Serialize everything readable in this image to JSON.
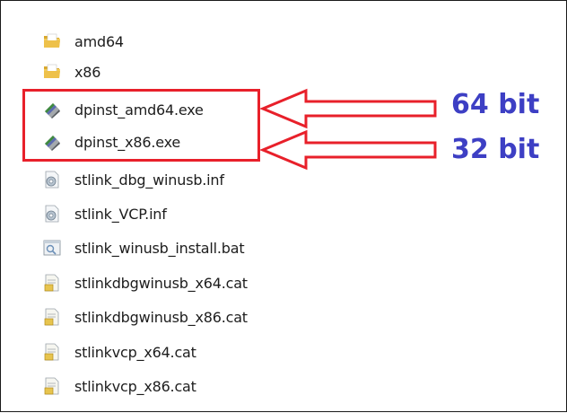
{
  "explorer": {
    "items": [
      {
        "name": "amd64",
        "icon": "folder-icon"
      },
      {
        "name": "x86",
        "icon": "folder-icon"
      },
      {
        "name": "dpinst_amd64.exe",
        "icon": "installer-icon"
      },
      {
        "name": "dpinst_x86.exe",
        "icon": "installer-icon"
      },
      {
        "name": "stlink_dbg_winusb.inf",
        "icon": "setup-info-icon"
      },
      {
        "name": "stlink_VCP.inf",
        "icon": "setup-info-icon"
      },
      {
        "name": "stlink_winusb_install.bat",
        "icon": "batch-file-icon"
      },
      {
        "name": "stlinkdbgwinusb_x64.cat",
        "icon": "catalog-file-icon"
      },
      {
        "name": "stlinkdbgwinusb_x86.cat",
        "icon": "catalog-file-icon"
      },
      {
        "name": "stlinkvcp_x64.cat",
        "icon": "catalog-file-icon"
      },
      {
        "name": "stlinkvcp_x86.cat",
        "icon": "catalog-file-icon"
      }
    ]
  },
  "annotations": {
    "label_64": "64 bit",
    "label_32": "32 bit",
    "arrow_color": "#e8202a",
    "label_color": "#3d3fc4"
  }
}
